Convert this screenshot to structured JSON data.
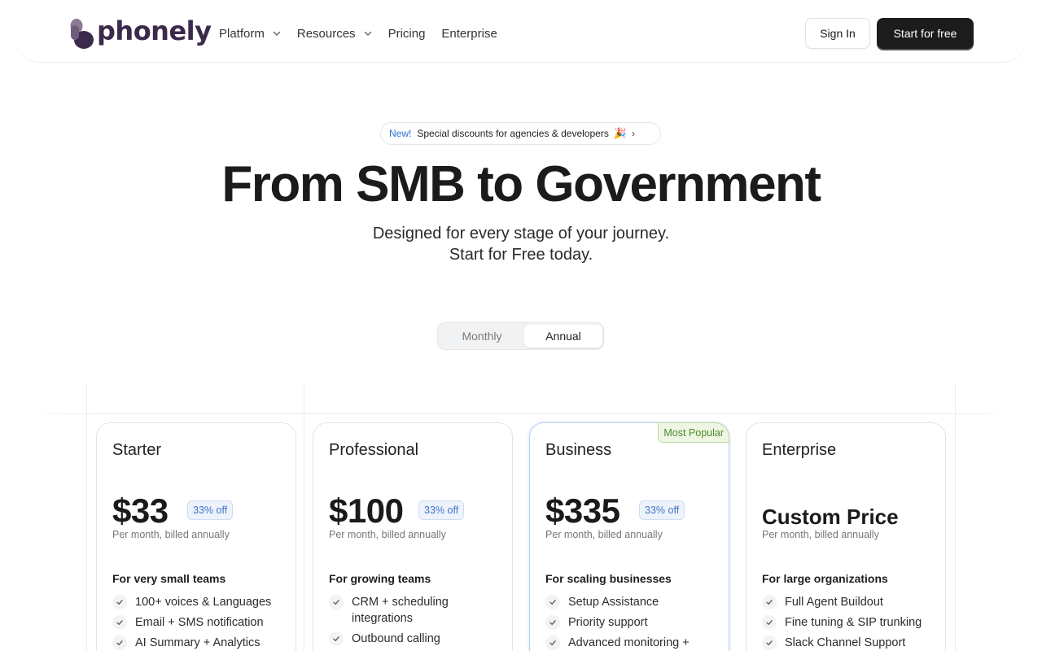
{
  "header": {
    "brand": "phonely",
    "nav": [
      {
        "label": "Platform",
        "has_dropdown": true
      },
      {
        "label": "Resources",
        "has_dropdown": true
      },
      {
        "label": "Pricing",
        "has_dropdown": false
      },
      {
        "label": "Enterprise",
        "has_dropdown": false
      }
    ],
    "sign_in": "Sign In",
    "start_free": "Start for free"
  },
  "announcement": {
    "tag": "New!",
    "text": "Special discounts for agencies & developers",
    "emoji": "🎉",
    "arrow": "›"
  },
  "hero": {
    "title": "From SMB to Government",
    "subtitle_line1": "Designed for every stage of your journey.",
    "subtitle_line2": "Start for Free today."
  },
  "billing_toggle": {
    "options": [
      "Monthly",
      "Annual"
    ],
    "selected": "Annual"
  },
  "plans": [
    {
      "name": "Starter",
      "price": "$33",
      "discount": "33% off",
      "billing": "Per month, billed annually",
      "audience": "For very small teams",
      "features": [
        "100+ voices & Languages",
        "Email + SMS notification",
        "AI Summary + Analytics"
      ]
    },
    {
      "name": "Professional",
      "price": "$100",
      "discount": "33% off",
      "billing": "Per month, billed annually",
      "audience": "For growing teams",
      "features": [
        "CRM + scheduling integrations",
        "Outbound calling"
      ]
    },
    {
      "name": "Business",
      "badge": "Most Popular",
      "price": "$335",
      "discount": "33% off",
      "billing": "Per month, billed annually",
      "audience": "For scaling businesses",
      "features": [
        "Setup Assistance",
        "Priority support",
        "Advanced monitoring +"
      ]
    },
    {
      "name": "Enterprise",
      "price": "Custom Price",
      "billing": "Per month, billed annually",
      "audience": "For large organizations",
      "features": [
        "Full Agent Buildout",
        "Fine tuning & SIP trunking",
        "Slack Channel Support"
      ]
    }
  ],
  "colors": {
    "brand": "#3b2a4a",
    "accent_blue": "#3f74c9",
    "badge_green": "#4a8a2a",
    "dark_button": "#1c1c1c"
  }
}
